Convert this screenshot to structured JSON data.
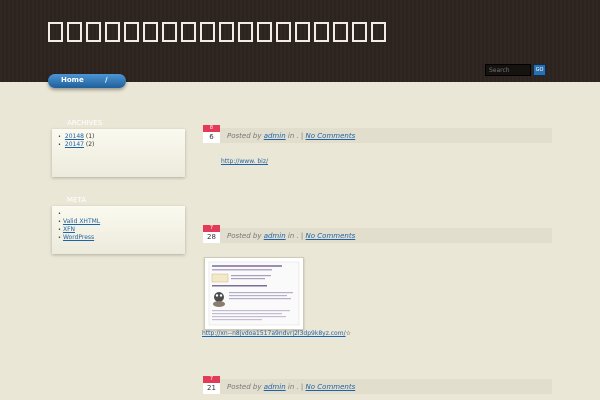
{
  "header": {
    "title": "□□□□□□□□□□□□□□□□□□",
    "nav": {
      "home_label": "Home",
      "sep_label": "/"
    },
    "search": {
      "placeholder": "Search",
      "button": "GO"
    }
  },
  "sidebar": {
    "archives": {
      "title": "ARCHIVES",
      "items": [
        {
          "label": "20148",
          "count": "(1)"
        },
        {
          "label": "20147",
          "count": "(2)"
        }
      ]
    },
    "meta": {
      "title": "META",
      "items": [
        {
          "label": ""
        },
        {
          "label": "Valid XHTML"
        },
        {
          "label": "XFN"
        },
        {
          "label": "WordPress"
        }
      ]
    }
  },
  "posts": [
    {
      "month": "8",
      "day": "6",
      "prefix": "Posted by",
      "author": "admin",
      "mid": "in . |",
      "comments": "No Comments",
      "link": "http://www. biz/"
    },
    {
      "month": "7",
      "day": "28",
      "prefix": "Posted by",
      "author": "admin",
      "mid": "in . |",
      "comments": "No Comments",
      "link": "http://xn--n8jvdoa1517a9ndvrj2l3dp9k8yz.com/",
      "link_suffix": "☆"
    },
    {
      "month": "7",
      "day": "21",
      "prefix": "Posted by",
      "author": "admin",
      "mid": "in . |",
      "comments": "No Comments"
    }
  ]
}
